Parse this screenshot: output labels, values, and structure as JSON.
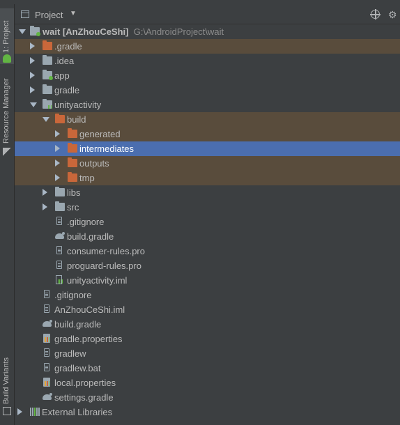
{
  "sidebar": {
    "project_tab": "1: Project",
    "resource_manager_tab": "Resource Manager",
    "build_variants_tab": "Build Variants"
  },
  "header": {
    "title": "Project"
  },
  "tree": {
    "root_name": "wait [AnZhouCeShi]",
    "root_path": "G:\\AndroidProject\\wait",
    "rows": [
      {
        "label": ".gradle"
      },
      {
        "label": ".idea"
      },
      {
        "label": "app"
      },
      {
        "label": "gradle"
      },
      {
        "label": "unityactivity"
      },
      {
        "label": "build"
      },
      {
        "label": "generated"
      },
      {
        "label": "intermediates"
      },
      {
        "label": "outputs"
      },
      {
        "label": "tmp"
      },
      {
        "label": "libs"
      },
      {
        "label": "src"
      },
      {
        "label": ".gitignore"
      },
      {
        "label": "build.gradle"
      },
      {
        "label": "consumer-rules.pro"
      },
      {
        "label": "proguard-rules.pro"
      },
      {
        "label": "unityactivity.iml"
      },
      {
        "label": ".gitignore"
      },
      {
        "label": "AnZhouCeShi.iml"
      },
      {
        "label": "build.gradle"
      },
      {
        "label": "gradle.properties"
      },
      {
        "label": "gradlew"
      },
      {
        "label": "gradlew.bat"
      },
      {
        "label": "local.properties"
      },
      {
        "label": "settings.gradle"
      },
      {
        "label": "External Libraries"
      }
    ]
  },
  "colors": {
    "background": "#3c3f41",
    "selection": "#4b6eaf",
    "excluded_highlight": "#594c3c",
    "excluded_folder": "#c9673a",
    "folder": "#9aa7b0"
  }
}
